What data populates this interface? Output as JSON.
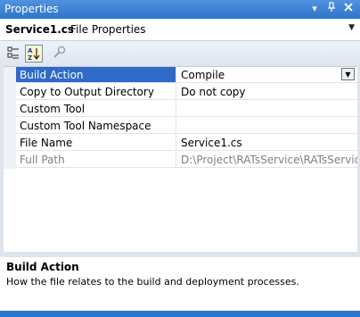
{
  "window": {
    "title": "Properties",
    "dropdown_glyph": "▾",
    "pin_glyph": "⊥",
    "close_glyph": "×"
  },
  "object_selector": {
    "name": "Service1.cs",
    "type": "File Properties"
  },
  "toolbar": {
    "icons": [
      "categorized-icon",
      "alphabetical-icon",
      "property-pages-icon"
    ],
    "alphabetical_selected": true
  },
  "properties": [
    {
      "label": "Build Action",
      "value": "Compile"
    },
    {
      "label": "Copy to Output Directory",
      "value": "Do not copy"
    },
    {
      "label": "Custom Tool",
      "value": ""
    },
    {
      "label": "Custom Tool Namespace",
      "value": ""
    },
    {
      "label": "File Name",
      "value": "Service1.cs"
    },
    {
      "label": "Full Path",
      "value": "D:\\Project\\RATsService\\RATsService\\S"
    }
  ],
  "description": {
    "title": "Build Action",
    "text": "How the file relates to the build and deployment processes."
  },
  "colors": {
    "titlebar": "#2e74c9",
    "selection": "#2e6ac7"
  }
}
